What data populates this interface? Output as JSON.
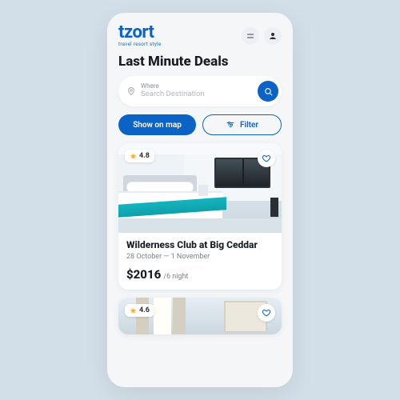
{
  "brand": {
    "name": "tzort",
    "tagline": "travel resort style"
  },
  "header": {
    "title": "Last Minute Deals"
  },
  "search": {
    "label": "Where",
    "placeholder": "Search Destination"
  },
  "controls": {
    "map_label": "Show on map",
    "filter_label": "Filter"
  },
  "listings": [
    {
      "rating": "4.8",
      "title": "Wilderness Club at Big Ceddar",
      "dates": "28 October — 1 November",
      "price": "$2016",
      "per": "/6 night"
    },
    {
      "rating": "4.6"
    }
  ]
}
